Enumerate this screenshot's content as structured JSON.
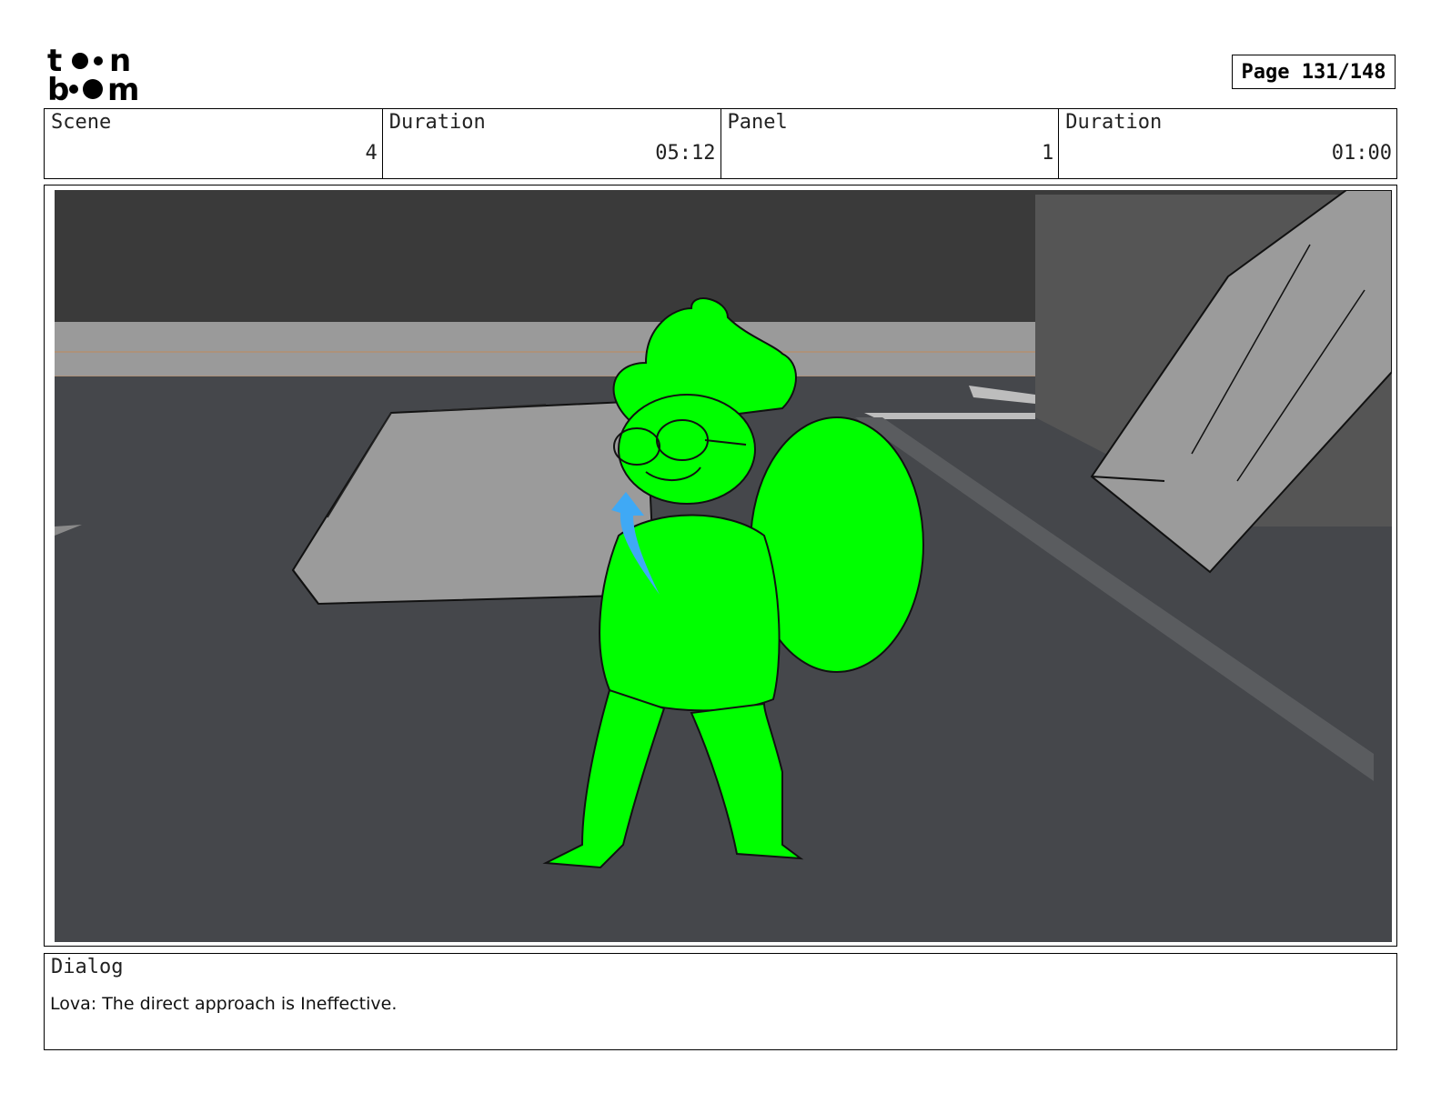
{
  "logo": {
    "line1": "toon",
    "line2": "boom"
  },
  "page": {
    "label": "Page 131/148"
  },
  "header": {
    "scene_label": "Scene",
    "scene_value": "4",
    "scene_duration_label": "Duration",
    "scene_duration_value": "05:12",
    "panel_label": "Panel",
    "panel_value": "1",
    "panel_duration_label": "Duration",
    "panel_duration_value": "01:00"
  },
  "panel": {
    "character_color": "#00ff00",
    "arrow_color": "#3fa9f5",
    "floor_color": "#45474b",
    "wall_color": "#3a3a3a"
  },
  "dialog": {
    "label": "Dialog",
    "text": "Lova: The direct approach is Ineffective."
  }
}
